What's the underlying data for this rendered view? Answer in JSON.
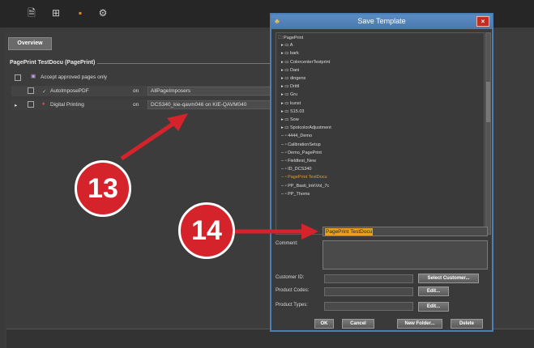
{
  "toolbar": {
    "icons": [
      "document-icon",
      "layout-icon",
      "users-icon",
      "settings-icon"
    ]
  },
  "main": {
    "overview_button": "Overview",
    "section_title": "PagePrint TestDocu (PagePrint)",
    "accept_label": "Accept approved pages only",
    "rows": [
      {
        "name": "AutoImposePDF",
        "state": "on",
        "value": "AllPageImposers"
      },
      {
        "name": "Digital Printing",
        "state": "on",
        "value": "DCS340_kie-qavm046 on KIE-QAVM040"
      }
    ]
  },
  "dialog": {
    "title": "Save Template",
    "close": "×",
    "tree": {
      "root": "PagePrint",
      "folders": [
        "A",
        "bark",
        "ColorcenterTestprint",
        "Dani",
        "dingens",
        "Drittl",
        "Gru",
        "kunst",
        "S15.03",
        "Sow",
        "SpotcolorAdjustment"
      ],
      "templates": [
        "4444_Demo",
        "CalibrationSetup",
        "Demo_PagePrint",
        "Fieldtest_New",
        "ID_DCS340",
        "PagePrint TestDocu",
        "PP_Basti_Ink\\Vol_7c",
        "PP_Thoms"
      ],
      "selected": "PagePrint TestDocu"
    },
    "name_value": "PagePrint TestDocu",
    "comment_label": "Comment:",
    "customer_id_label": "Customer ID:",
    "product_codes_label": "Product Codes:",
    "product_types_label": "Product Types:",
    "select_customer_button": "Select Customer...",
    "edit_button_1": "Edit...",
    "edit_button_2": "Edit...",
    "ok_button": "OK",
    "cancel_button": "Cancel",
    "new_folder_button": "New Folder...",
    "delete_button": "Delete"
  },
  "callouts": {
    "badge_13": "13",
    "badge_14": "14",
    "color": "#d4232a"
  }
}
